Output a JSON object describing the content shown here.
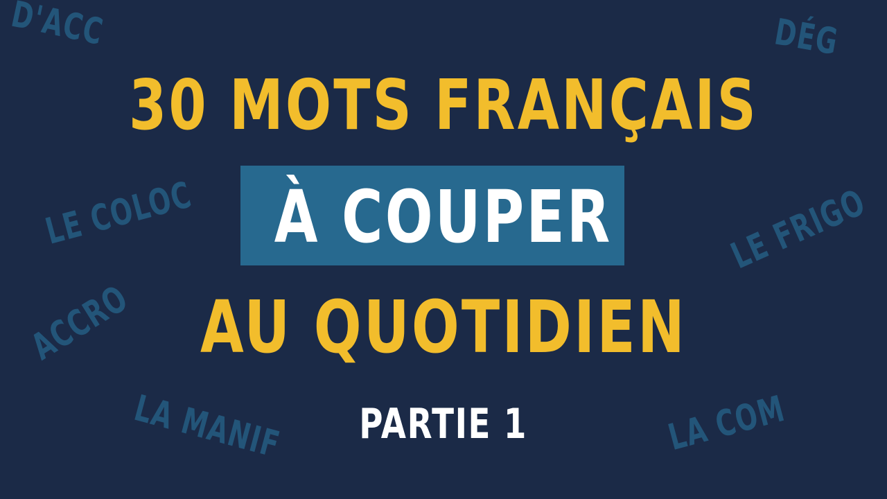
{
  "background_words": {
    "dacc": "D'ACC",
    "deg": "DÉG",
    "coloc": "LE COLOC",
    "accro": "ACCRO",
    "frigo": "LE FRIGO",
    "manif": "LA MANIF",
    "com": "LA COM"
  },
  "title": {
    "line1": "30 MOTS FRANÇAIS",
    "line2": "À COUPER",
    "line3": "AU QUOTIDIEN"
  },
  "subtitle": "PARTIE 1",
  "colors": {
    "background": "#1b2a47",
    "accent_yellow": "#f2bd2c",
    "highlight_blue": "#27698f",
    "faded_word_blue": "#235579",
    "white": "#ffffff"
  }
}
